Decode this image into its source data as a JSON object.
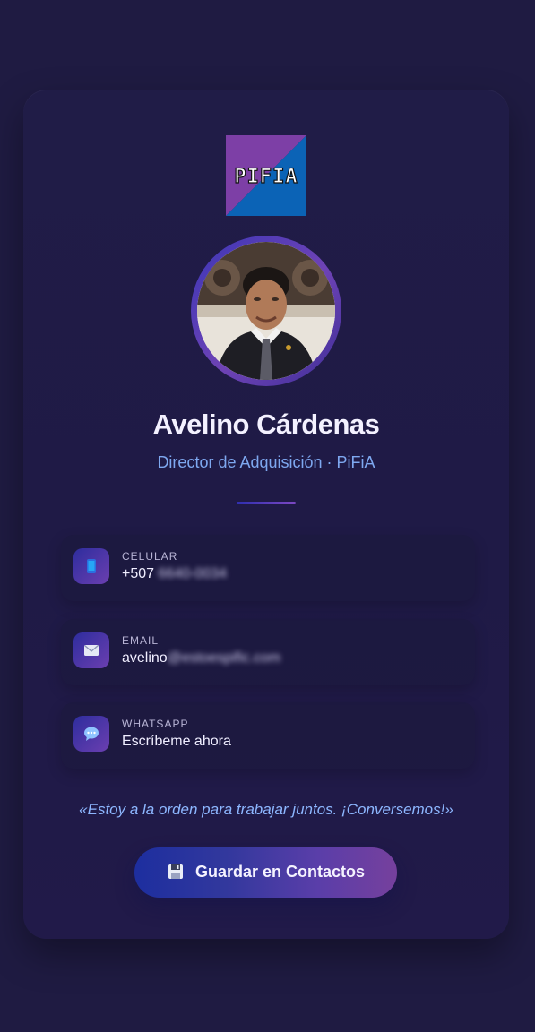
{
  "profile": {
    "logo_text": "PIFIA",
    "name": "Avelino Cárdenas",
    "title": "Director de Adquisición · PiFiA",
    "quote": "«Estoy a la orden para trabajar juntos. ¡Conversemos!»"
  },
  "contacts": [
    {
      "label": "CELULAR",
      "value_visible": "+507",
      "value_blurred": " 6640-0034",
      "icon": "phone-icon"
    },
    {
      "label": "EMAIL",
      "value_visible": "avelino",
      "value_blurred": "@estoespific.com",
      "icon": "mail-icon"
    },
    {
      "label": "WHATSAPP",
      "value_visible": "Escríbeme ahora",
      "value_blurred": "",
      "icon": "chat-icon"
    }
  ],
  "actions": {
    "save_label": "Guardar en Contactos",
    "save_icon": "save-icon"
  },
  "colors": {
    "background": "#1f1b42",
    "accent_blue": "#7ea8f0",
    "accent_purple": "#76409d"
  }
}
